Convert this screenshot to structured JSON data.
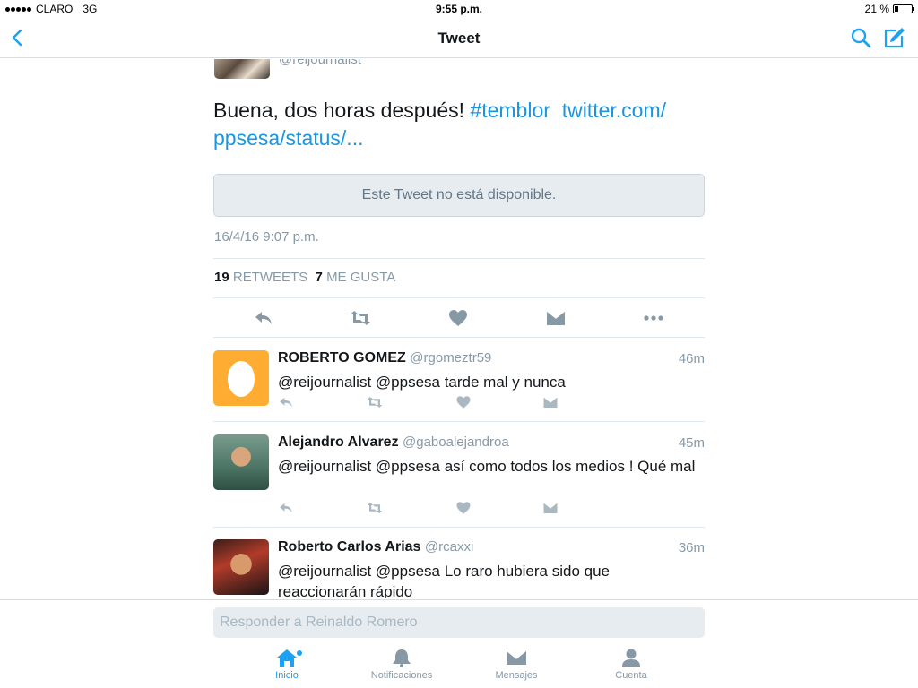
{
  "status_bar": {
    "carrier": "CLARO",
    "network": "3G",
    "time": "9:55 p.m.",
    "battery_text": "21 %",
    "battery_level": 0.21
  },
  "nav": {
    "title": "Tweet",
    "back_icon": "chevron-left-icon",
    "search_icon": "search-icon",
    "compose_icon": "compose-icon"
  },
  "main_tweet": {
    "handle": "@reijournalist",
    "text_plain": "Buena, dos horas después! ",
    "hashtag": "#temblor",
    "link": "twitter.com/ ppsesa/status/...",
    "unavailable_notice": "Este Tweet no está disponible.",
    "timestamp": "16/4/16 9:07 p.m.",
    "retweets_count": "19",
    "retweets_label": "RETWEETS",
    "likes_count": "7",
    "likes_label": "ME GUSTA"
  },
  "replies": [
    {
      "name": "ROBERTO GOMEZ",
      "handle": "@rgomeztr59",
      "time": "46m",
      "text": "@reijournalist @ppsesa tarde mal y nunca"
    },
    {
      "name": "Alejandro Alvarez",
      "handle": "@gaboalejandroa",
      "time": "45m",
      "text": "@reijournalist @ppsesa así como todos los medios ! Qué mal"
    },
    {
      "name": "Roberto Carlos Arias",
      "handle": "@rcaxxi",
      "time": "36m",
      "text": "@reijournalist @ppsesa Lo raro hubiera sido que reaccionarán rápido"
    }
  ],
  "composer": {
    "placeholder": "Responder a Reinaldo Romero",
    "value": ""
  },
  "tabs": [
    {
      "label": "Inicio",
      "icon": "home-icon",
      "active": true
    },
    {
      "label": "Notificaciones",
      "icon": "bell-icon",
      "active": false
    },
    {
      "label": "Mensajes",
      "icon": "envelope-icon",
      "active": false
    },
    {
      "label": "Cuenta",
      "icon": "person-icon",
      "active": false
    }
  ],
  "colors": {
    "accent": "#1da1f2",
    "link": "#1b95e0",
    "muted": "#8899a6",
    "icon": "#8899a6",
    "egg_avatar": "#ffac33"
  }
}
